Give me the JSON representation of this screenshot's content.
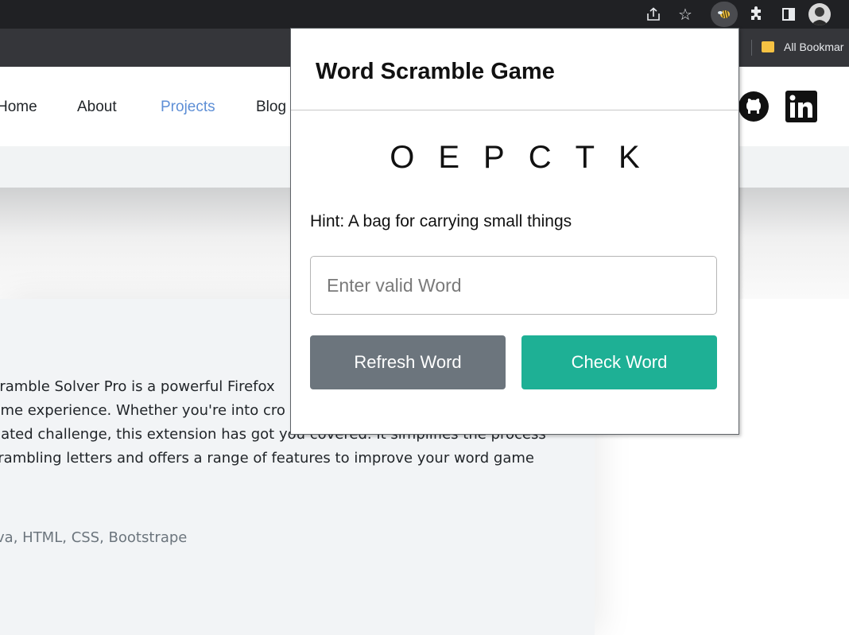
{
  "browser": {
    "bookmarks_label": "All Bookmar",
    "icons": [
      "share-icon",
      "star-icon",
      "extension-active-icon",
      "puzzle-icon",
      "side-panel-icon",
      "avatar"
    ]
  },
  "site": {
    "nav": [
      {
        "label": "Home"
      },
      {
        "label": "About"
      },
      {
        "label": "Projects",
        "active": true
      },
      {
        "label": "Blog"
      }
    ],
    "social_icons": [
      "github-icon",
      "linkedin-icon"
    ],
    "description_lines": [
      "Scramble Solver Pro is a powerful Firefox",
      "game experience. Whether you're into cro",
      "related challenge, this extension has got you covered. It simplifies the process",
      "scrambling letters and offers a range of features to improve your word game"
    ],
    "tech_stack": "ava, HTML, CSS, Bootstrape",
    "accent_color": "#5e8fd6"
  },
  "popup": {
    "title": "Word Scramble Game",
    "scrambled_word": "OEPCTK",
    "hint": "Hint: A bag for carrying small things",
    "input": {
      "value": "",
      "placeholder": "Enter valid Word"
    },
    "refresh_label": "Refresh Word",
    "check_label": "Check Word",
    "colors": {
      "refresh": "#6c757d",
      "check": "#1eb095"
    }
  }
}
